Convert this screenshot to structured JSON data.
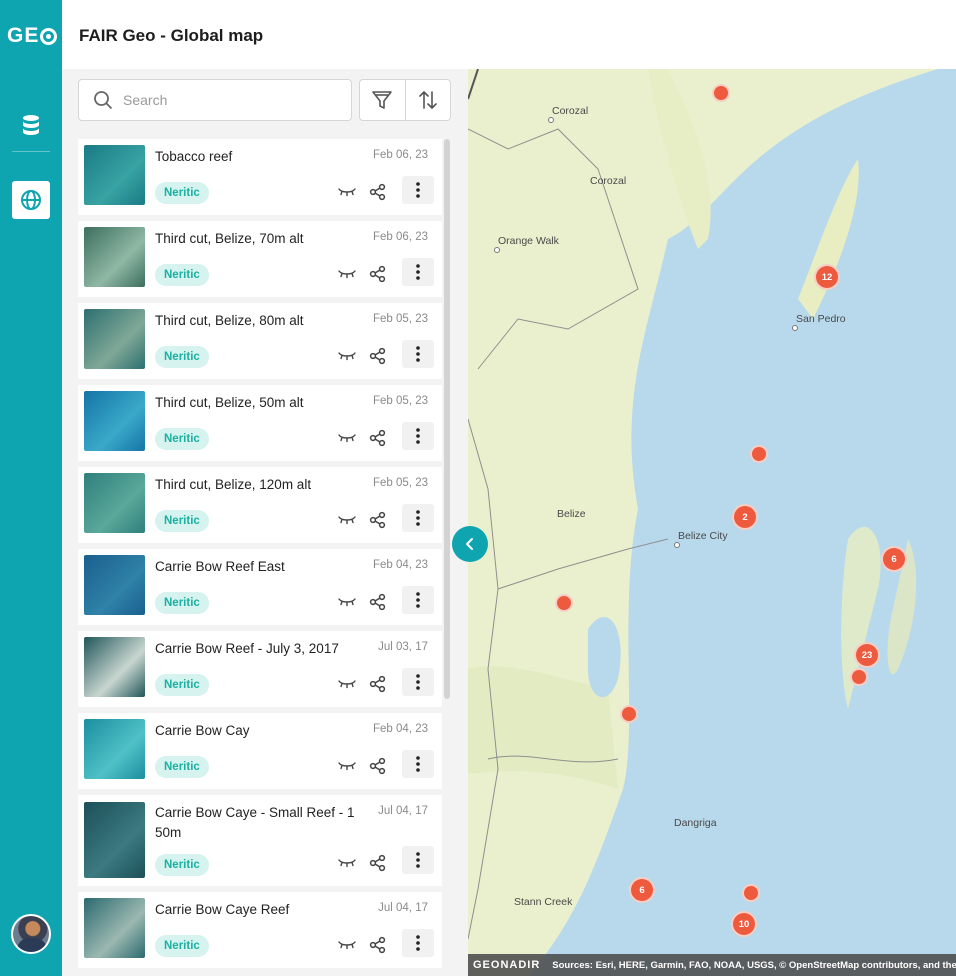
{
  "app": {
    "logo": "GE",
    "title": "FAIR Geo - Global map"
  },
  "rail": {
    "items": [
      {
        "icon": "database-icon"
      },
      {
        "icon": "globe-icon",
        "active": true
      }
    ]
  },
  "search": {
    "placeholder": "Search"
  },
  "toolbar": {
    "filter_icon": "filter-icon",
    "sort_icon": "sort-icon"
  },
  "datasets": [
    {
      "name": "Tobacco reef",
      "date": "Feb 06, 23",
      "tag": "Neritic",
      "thumb": [
        "#1a7a86",
        "#38a3a3"
      ]
    },
    {
      "name": "Third cut, Belize, 70m alt",
      "date": "Feb 06, 23",
      "tag": "Neritic",
      "thumb": [
        "#3c6e5e",
        "#8fb8a4"
      ]
    },
    {
      "name": "Third cut, Belize, 80m alt",
      "date": "Feb 05, 23",
      "tag": "Neritic",
      "thumb": [
        "#2d6f70",
        "#7fa896"
      ]
    },
    {
      "name": "Third cut, Belize, 50m alt",
      "date": "Feb 05, 23",
      "tag": "Neritic",
      "thumb": [
        "#1574a6",
        "#3aa9c9"
      ]
    },
    {
      "name": "Third cut, Belize, 120m alt",
      "date": "Feb 05, 23",
      "tag": "Neritic",
      "thumb": [
        "#2f7f7c",
        "#5aa89a"
      ]
    },
    {
      "name": "Carrie Bow Reef East",
      "date": "Feb 04, 23",
      "tag": "Neritic",
      "thumb": [
        "#1a5f8e",
        "#2f82a8"
      ]
    },
    {
      "name": "Carrie Bow Reef - July 3, 2017",
      "date": "Jul 03, 17",
      "tag": "Neritic",
      "thumb": [
        "#20565a",
        "#c9d6d0"
      ]
    },
    {
      "name": "Carrie Bow Cay",
      "date": "Feb 04, 23",
      "tag": "Neritic",
      "thumb": [
        "#1b8fa0",
        "#4fc0c6"
      ]
    },
    {
      "name": "Carrie Bow Caye - Small Reef - 1 50m",
      "date": "Jul 04, 17",
      "tag": "Neritic",
      "thumb": [
        "#1d4f58",
        "#3b7a80"
      ]
    },
    {
      "name": "Carrie Bow Caye Reef",
      "date": "Jul 04, 17",
      "tag": "Neritic",
      "thumb": [
        "#2b6a70",
        "#9bb8b0"
      ]
    }
  ],
  "map": {
    "places": [
      "Corozal",
      "Corozal",
      "Orange Walk",
      "San Pedro",
      "Belize",
      "Belize City",
      "Dangriga",
      "Stann Creek"
    ],
    "clusters": [
      {
        "count": "12"
      },
      {
        "count": "2"
      },
      {
        "count": "6"
      },
      {
        "count": "23"
      },
      {
        "count": "6"
      },
      {
        "count": "10"
      },
      {
        "count": ""
      },
      {
        "count": ""
      },
      {
        "count": ""
      },
      {
        "count": ""
      },
      {
        "count": ""
      },
      {
        "count": ""
      }
    ],
    "marker_color": "#ee5a3e",
    "attribution_logo": "GEONADIR",
    "attribution": "Sources: Esri, HERE, Garmin, FAO, NOAA, USGS, © OpenStreetMap contributors, and the GIS User Community"
  },
  "colors": {
    "accent": "#0fa5b0",
    "tag_bg": "#d6f3f0",
    "tag_text": "#1cb0a0"
  }
}
